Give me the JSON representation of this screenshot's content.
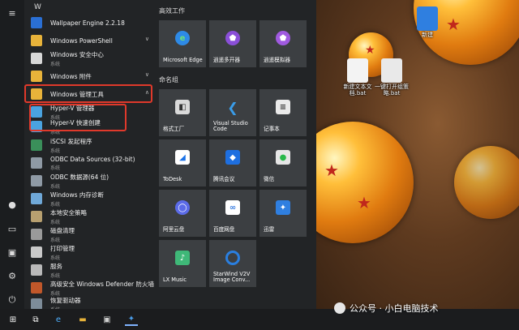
{
  "desktop": {
    "icons": [
      {
        "label": "新建",
        "name": "desktop-icon-xunlei"
      },
      {
        "label": "新建文本文档.bat",
        "name": "desktop-icon-bat1"
      },
      {
        "label": "一键打开组策略.bat",
        "name": "desktop-icon-bat2"
      }
    ]
  },
  "applist": {
    "letter": "W",
    "items": [
      {
        "name": "Wallpaper Engine 2.2.18",
        "sub": ""
      },
      {
        "name": "Windows PowerShell",
        "sub": ""
      },
      {
        "name": "Windows 安全中心",
        "sub": "系统"
      },
      {
        "name": "Windows 附件",
        "sub": ""
      },
      {
        "name": "Windows 管理工具",
        "sub": ""
      },
      {
        "name": "Hyper-V 管理器",
        "sub": "系统"
      },
      {
        "name": "Hyper-V 快速创建",
        "sub": "系统"
      },
      {
        "name": "iSCSI 发起程序",
        "sub": "系统"
      },
      {
        "name": "ODBC Data Sources (32-bit)",
        "sub": "系统"
      },
      {
        "name": "ODBC 数据源(64 位)",
        "sub": "系统"
      },
      {
        "name": "Windows 内存诊断",
        "sub": "系统"
      },
      {
        "name": "本地安全策略",
        "sub": "系统"
      },
      {
        "name": "磁盘清理",
        "sub": "系统"
      },
      {
        "name": "打印管理",
        "sub": "系统"
      },
      {
        "name": "服务",
        "sub": "系统"
      },
      {
        "name": "高级安全 Windows Defender 防火墙",
        "sub": "系统"
      },
      {
        "name": "恢复驱动器",
        "sub": "系统"
      }
    ]
  },
  "tiles": {
    "group1_title": "高效工作",
    "group2_title": "命名组",
    "items": [
      {
        "label": "Microsoft Edge"
      },
      {
        "label": "逍遥多开器"
      },
      {
        "label": "逍遥模拟器"
      },
      {
        "label": "格式工厂"
      },
      {
        "label": "Visual Studio Code"
      },
      {
        "label": "记事本"
      },
      {
        "label": "ToDesk"
      },
      {
        "label": "腾讯会议"
      },
      {
        "label": "微信"
      },
      {
        "label": "阿里云盘"
      },
      {
        "label": "百度网盘"
      },
      {
        "label": "迅雷"
      },
      {
        "label": "LX Music"
      },
      {
        "label": "StarWind V2V Image Conv..."
      }
    ]
  },
  "watermark": "公众号 · 小白电脑技术",
  "colors": {
    "highlight": "#e0392b",
    "tile_bg": "#3c3f42",
    "menu_bg": "#222426"
  }
}
